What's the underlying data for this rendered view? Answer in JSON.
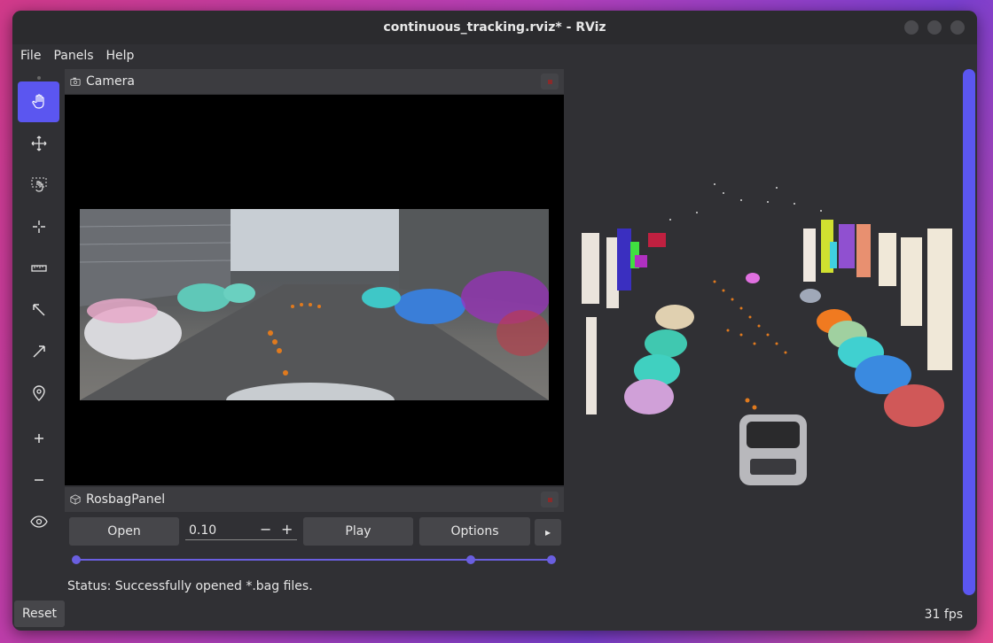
{
  "window": {
    "title": "continuous_tracking.rviz* - RViz"
  },
  "menu": {
    "file": "File",
    "panels": "Panels",
    "help": "Help"
  },
  "toolbar": {
    "tools": [
      "interact",
      "move-camera",
      "select",
      "focus-camera",
      "measure",
      "2d-pose-estimate",
      "2d-nav-goal",
      "publish-point",
      "add",
      "remove",
      "view"
    ]
  },
  "camera_panel": {
    "title": "Camera"
  },
  "rosbag_panel": {
    "title": "RosbagPanel",
    "open_label": "Open",
    "rate_value": "0.10",
    "minus_label": "−",
    "plus_label": "+",
    "play_label": "Play",
    "options_label": "Options",
    "more_label": "▸"
  },
  "timeline": {
    "start": 0.0,
    "current": 0.83,
    "end": 1.0
  },
  "status": {
    "text": "Status: Successfully opened *.bag files."
  },
  "footer": {
    "reset_label": "Reset",
    "fps": "31 fps"
  },
  "colors": {
    "accent": "#5b56f0",
    "window_bg": "#303034",
    "panel_header": "#3c3c40"
  }
}
